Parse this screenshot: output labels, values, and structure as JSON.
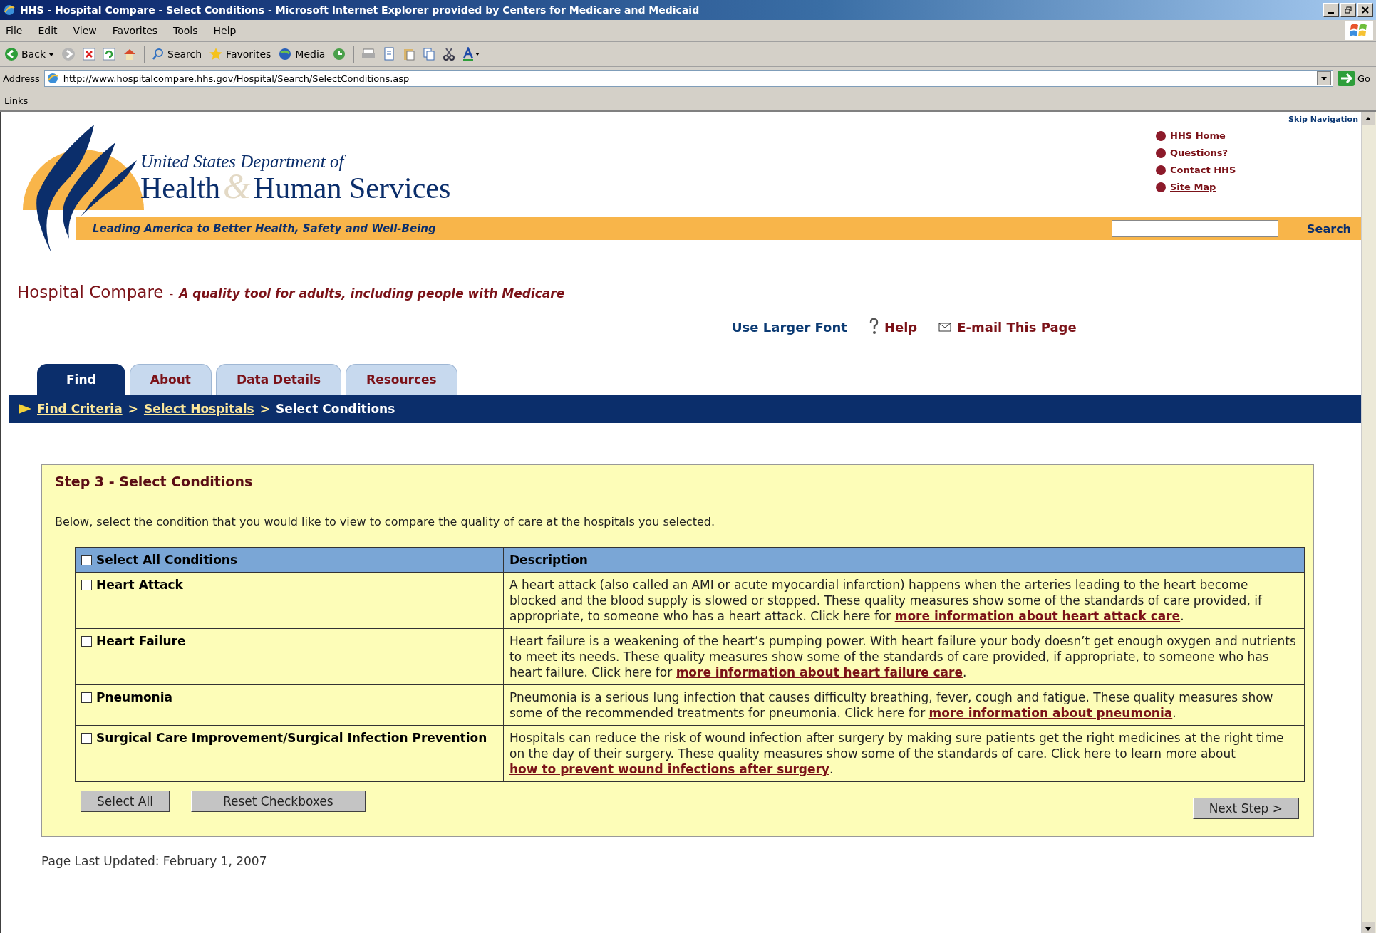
{
  "window": {
    "title": "HHS - Hospital Compare - Select Conditions - Microsoft Internet Explorer provided by Centers for Medicare and Medicaid"
  },
  "menu": [
    "File",
    "Edit",
    "View",
    "Favorites",
    "Tools",
    "Help"
  ],
  "toolbar": {
    "back": "Back",
    "search": "Search",
    "favorites": "Favorites",
    "media": "Media"
  },
  "address_bar": {
    "label": "Address",
    "url": "http://www.hospitalcompare.hhs.gov/Hospital/Search/SelectConditions.asp",
    "go": "Go"
  },
  "links_bar": {
    "label": "Links"
  },
  "header": {
    "skip_navigation": "Skip Navigation",
    "org_line": "United States Department of",
    "org_name_1": "Health",
    "ampersand": "&",
    "org_name_2": "Human Services",
    "tagline": "Leading America to Better Health, Safety and Well-Being",
    "links": [
      "HHS Home",
      "Questions?",
      "Contact HHS",
      "Site Map"
    ],
    "search_button": "Search"
  },
  "app": {
    "title": "Hospital Compare",
    "separator": "-",
    "subtitle": "A quality tool for adults, including people with Medicare"
  },
  "utility_links": [
    {
      "kind": "font",
      "label": "Use Larger Font"
    },
    {
      "kind": "help",
      "label": "Help"
    },
    {
      "kind": "email",
      "label": "E-mail This Page"
    }
  ],
  "tabs": [
    {
      "label": "Find",
      "selected": true
    },
    {
      "label": "About",
      "selected": false
    },
    {
      "label": "Data Details",
      "selected": false
    },
    {
      "label": "Resources",
      "selected": false
    }
  ],
  "breadcrumb": {
    "links": [
      "Find Criteria",
      "Select Hospitals"
    ],
    "separator": ">",
    "current": "Select Conditions"
  },
  "step": {
    "title": "Step 3 - Select Conditions",
    "intro": "Below, select the condition that you would like to view to compare the quality of care at the hospitals you selected.",
    "table": {
      "select_all": {
        "label": "Select All Conditions",
        "checked": false
      },
      "description_header": "Description",
      "rows": [
        {
          "name": "Heart Attack",
          "checked": false,
          "description": "A heart attack (also called an AMI or acute myocardial infarction) happens when the arteries leading to the heart become blocked and the blood supply is slowed or stopped. These quality measures show some of the standards of care provided, if appropriate, to someone who has a heart attack. Click here for",
          "link": "more information about heart attack care",
          "after": "."
        },
        {
          "name": "Heart Failure",
          "checked": false,
          "description": "Heart failure is a weakening of the heart’s pumping power. With heart failure your body doesn’t get enough oxygen and nutrients to meet its needs. These quality measures show some of the standards of care provided, if appropriate, to someone who has heart failure. Click here for",
          "link": "more information about heart failure care",
          "after": "."
        },
        {
          "name": "Pneumonia",
          "checked": false,
          "description": "Pneumonia is a serious lung infection that causes difficulty breathing, fever, cough and fatigue. These quality measures show some of the recommended treatments for pneumonia. Click here for",
          "link": "more information about pneumonia",
          "after": "."
        },
        {
          "name": "Surgical Care Improvement/Surgical Infection Prevention",
          "checked": false,
          "description": "Hospitals can reduce the risk of wound infection after surgery by making sure patients get the right medicines at the right time on the day of their surgery. These quality measures show some of the standards of care. Click here to learn more about",
          "link": "how to prevent wound infections after surgery",
          "after": "."
        }
      ]
    },
    "buttons": [
      "Select All",
      "Reset Checkboxes"
    ],
    "next_button": "Next Step >"
  },
  "footer": {
    "updated": "Page Last Updated: February 1, 2007"
  }
}
